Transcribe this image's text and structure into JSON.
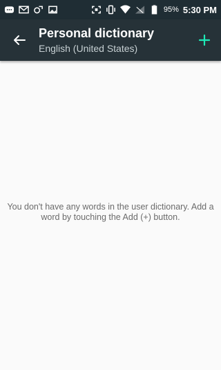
{
  "status_bar": {
    "icons": [
      "message-icon",
      "gmail-icon",
      "photo-sync-icon",
      "image-icon",
      "screenshot-icon",
      "vibrate-icon",
      "wifi-icon",
      "no-signal-icon",
      "battery-icon"
    ],
    "battery_percent": "95%",
    "time": "5:30 PM"
  },
  "app_bar": {
    "title": "Personal dictionary",
    "subtitle": "English (United States)",
    "accent_color": "#1de9b6",
    "background_color": "#263238"
  },
  "content": {
    "empty_message": "You don't have any words in the user dictionary. Add a word by touching the Add (+) button."
  }
}
